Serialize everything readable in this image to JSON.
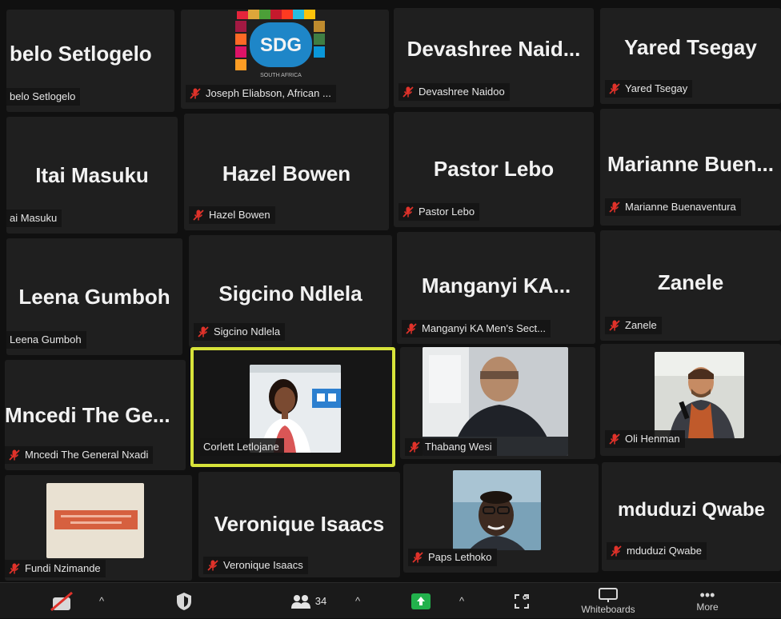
{
  "tiles": [
    {
      "name": "belo Setlogelo",
      "label": "belo Setlogelo"
    },
    {
      "name": "",
      "label": "Joseph Eliabson, African ..."
    },
    {
      "name": "Devashree  Naid...",
      "label": "Devashree Naidoo"
    },
    {
      "name": "Yared Tsegay",
      "label": "Yared Tsegay"
    },
    {
      "name": "Itai Masuku",
      "label": "ai Masuku"
    },
    {
      "name": "Hazel Bowen",
      "label": "Hazel Bowen"
    },
    {
      "name": "Pastor Lebo",
      "label": "Pastor Lebo"
    },
    {
      "name": "Marianne  Buen...",
      "label": "Marianne Buenaventura"
    },
    {
      "name": "Leena Gumboh",
      "label": "Leena Gumboh"
    },
    {
      "name": "Sigcino Ndlela",
      "label": "Sigcino Ndlela"
    },
    {
      "name": "Manganyi  KA...",
      "label": "Manganyi KA Men's Sect..."
    },
    {
      "name": "Zanele",
      "label": "Zanele"
    },
    {
      "name": "Mncedi  The  Ge...",
      "label": "Mncedi The General Nxadi"
    },
    {
      "name": "",
      "label": "Corlett Letlojane"
    },
    {
      "name": "",
      "label": "Thabang Wesi"
    },
    {
      "name": "",
      "label": "Oli Henman"
    },
    {
      "name": "",
      "label": "Fundi Nzimande"
    },
    {
      "name": "Veronique Isaacs",
      "label": "Veronique Isaacs"
    },
    {
      "name": "",
      "label": "Paps Lethoko"
    },
    {
      "name": "mduduzi Qwabe",
      "label": "mduduzi Qwabe"
    }
  ],
  "sdg_logo": {
    "text": "SDG",
    "subtext": "SOUTH AFRICA"
  },
  "toolbar": {
    "participants_count": "34",
    "whiteboards_label": "Whiteboards",
    "more_label": "More"
  },
  "colors": {
    "speaking_border": "#d7e33a",
    "mute_red": "#e0322a",
    "share_green": "#22b14c"
  }
}
